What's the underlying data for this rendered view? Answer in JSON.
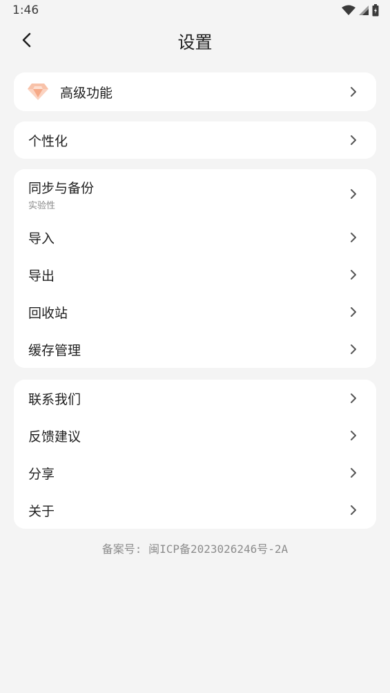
{
  "status_bar": {
    "time": "1:46"
  },
  "header": {
    "title": "设置"
  },
  "premium": {
    "label": "高级功能"
  },
  "personalize": {
    "label": "个性化"
  },
  "data_section": {
    "sync_title": "同步与备份",
    "sync_subtitle": "实验性",
    "items": [
      {
        "label": "导入"
      },
      {
        "label": "导出"
      },
      {
        "label": "回收站"
      },
      {
        "label": "缓存管理"
      }
    ]
  },
  "about_section": {
    "items": [
      {
        "label": "联系我们"
      },
      {
        "label": "反馈建议"
      },
      {
        "label": "分享"
      },
      {
        "label": "关于"
      }
    ]
  },
  "footer": {
    "icp": "备案号: 闽ICP备2023026246号-2A"
  },
  "colors": {
    "background": "#f4f4f4",
    "card": "#ffffff",
    "gem": "#f6b59a",
    "muted": "#8a8a8a"
  }
}
